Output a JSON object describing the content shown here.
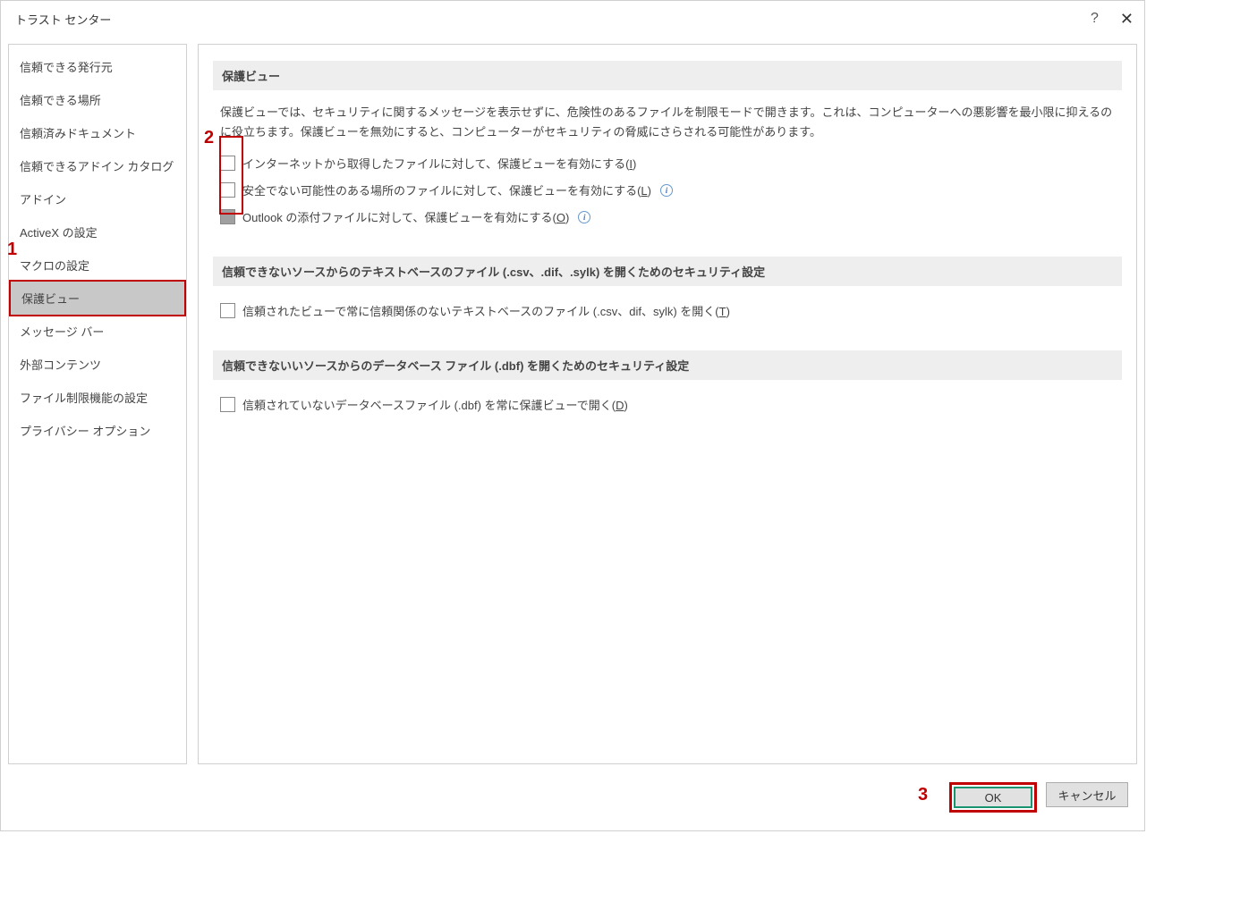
{
  "window": {
    "title": "トラスト センター"
  },
  "titlebar": {
    "help": "?",
    "close": "✕"
  },
  "sidebar": {
    "items": [
      {
        "id": "trusted-publishers",
        "label": "信頼できる発行元"
      },
      {
        "id": "trusted-locations",
        "label": "信頼できる場所"
      },
      {
        "id": "trusted-documents",
        "label": "信頼済みドキュメント"
      },
      {
        "id": "trusted-addins",
        "label": "信頼できるアドイン カタログ"
      },
      {
        "id": "addins",
        "label": "アドイン"
      },
      {
        "id": "activex",
        "label": "ActiveX の設定"
      },
      {
        "id": "macro",
        "label": "マクロの設定"
      },
      {
        "id": "protected-view",
        "label": "保護ビュー"
      },
      {
        "id": "message-bar",
        "label": "メッセージ バー"
      },
      {
        "id": "external-content",
        "label": "外部コンテンツ"
      },
      {
        "id": "file-block",
        "label": "ファイル制限機能の設定"
      },
      {
        "id": "privacy",
        "label": "プライバシー オプション"
      }
    ]
  },
  "main": {
    "section1": {
      "header": "保護ビュー",
      "description": "保護ビューでは、セキュリティに関するメッセージを表示せずに、危険性のあるファイルを制限モードで開きます。これは、コンピューターへの悪影響を最小限に抑えるのに役立ちます。保護ビューを無効にすると、コンピューターがセキュリティの脅威にさらされる可能性があります。",
      "checkboxes": [
        {
          "label_pre": "インターネットから取得したファイルに対して、保護ビューを有効にする(",
          "key": "I",
          "label_post": ")",
          "info": false
        },
        {
          "label_pre": "安全でない可能性のある場所のファイルに対して、保護ビューを有効にする(",
          "key": "L",
          "label_post": ")",
          "info": true
        },
        {
          "label_pre": "Outlook の添付ファイルに対して、保護ビューを有効にする(",
          "key": "O",
          "label_post": ")",
          "info": true,
          "gray": true
        }
      ]
    },
    "section2": {
      "header": "信頼できないソースからのテキストベースのファイル (.csv、.dif、.sylk) を開くためのセキュリティ設定",
      "checkbox": {
        "label_pre": "信頼されたビューで常に信頼関係のないテキストベースのファイル (.csv、dif、sylk) を開く(",
        "key": "T",
        "label_post": ")"
      }
    },
    "section3": {
      "header": "信頼できないいソースからのデータベース ファイル (.dbf) を開くためのセキュリティ設定",
      "checkbox": {
        "label_pre": "信頼されていないデータベースファイル (.dbf) を常に保護ビューで開く(",
        "key": "D",
        "label_post": ")"
      }
    }
  },
  "buttons": {
    "ok": "OK",
    "cancel": "キャンセル"
  },
  "annotations": {
    "a1": "1",
    "a2": "2",
    "a3": "3"
  }
}
